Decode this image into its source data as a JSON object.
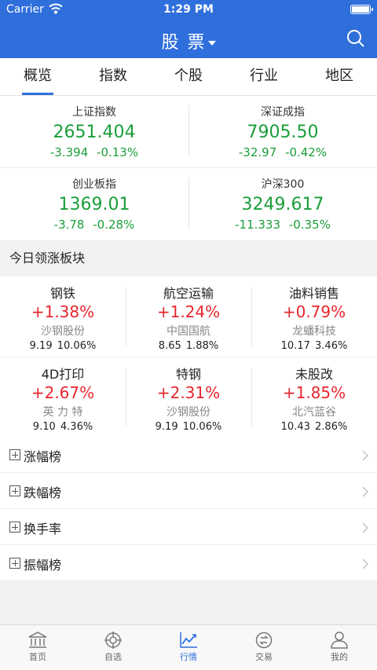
{
  "status": {
    "carrier": "Carrier",
    "time": "1:29 PM",
    "battery_level": 1.0
  },
  "nav": {
    "title": "股 票"
  },
  "tabs": [
    {
      "label": "概览",
      "active": true
    },
    {
      "label": "指数"
    },
    {
      "label": "个股"
    },
    {
      "label": "行业"
    },
    {
      "label": "地区"
    }
  ],
  "indices": [
    {
      "name": "上证指数",
      "value": "2651.404",
      "change": "-3.394",
      "pct": "-0.13%"
    },
    {
      "name": "深证成指",
      "value": "7905.50",
      "change": "-32.97",
      "pct": "-0.42%"
    },
    {
      "name": "创业板指",
      "value": "1369.01",
      "change": "-3.78",
      "pct": "-0.28%"
    },
    {
      "name": "沪深300",
      "value": "3249.617",
      "change": "-11.333",
      "pct": "-0.35%"
    }
  ],
  "sectors_header": "今日领涨板块",
  "sectors": [
    {
      "name": "钢铁",
      "pct": "+1.38%",
      "leader": "沙钢股份",
      "price": "9.19",
      "leader_pct": "10.06%"
    },
    {
      "name": "航空运输",
      "pct": "+1.24%",
      "leader": "中国国航",
      "price": "8.65",
      "leader_pct": "1.88%"
    },
    {
      "name": "油料销售",
      "pct": "+0.79%",
      "leader": "龙蟠科技",
      "price": "10.17",
      "leader_pct": "3.46%"
    },
    {
      "name": "4D打印",
      "pct": "+2.67%",
      "leader": "英 力 特",
      "price": "9.10",
      "leader_pct": "4.36%"
    },
    {
      "name": "特钢",
      "pct": "+2.31%",
      "leader": "沙钢股份",
      "price": "9.19",
      "leader_pct": "10.06%"
    },
    {
      "name": "未股改",
      "pct": "+1.85%",
      "leader": "北汽蓝谷",
      "price": "10.43",
      "leader_pct": "2.86%"
    }
  ],
  "rankings": [
    {
      "label": "涨幅榜"
    },
    {
      "label": "跌幅榜"
    },
    {
      "label": "换手率"
    },
    {
      "label": "振幅榜"
    }
  ],
  "tab_bar": [
    {
      "label": "首页",
      "icon": "bank-icon"
    },
    {
      "label": "自选",
      "icon": "target-icon"
    },
    {
      "label": "行情",
      "icon": "chart-icon",
      "active": true
    },
    {
      "label": "交易",
      "icon": "exchange-icon"
    },
    {
      "label": "我的",
      "icon": "person-icon"
    }
  ],
  "colors": {
    "brand": "#2f6fdc",
    "up": "#e8262e",
    "down": "#1a9e3a"
  }
}
